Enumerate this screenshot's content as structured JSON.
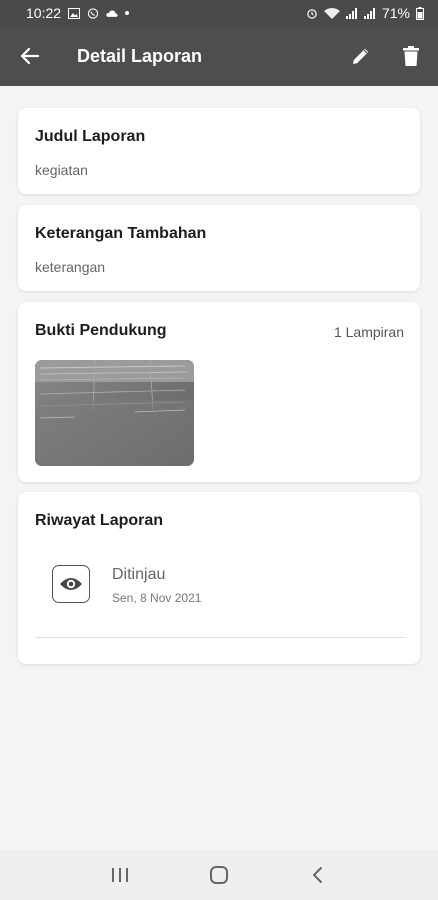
{
  "status_bar": {
    "time": "10:22",
    "battery": "71%",
    "left_icons": [
      "image-icon",
      "whatsapp-icon",
      "cloud-icon",
      "dot-icon"
    ],
    "right_icons": [
      "alarm-icon",
      "wifi-icon",
      "signal-icon",
      "signal-icon"
    ]
  },
  "app_bar": {
    "title": "Detail Laporan",
    "back_icon": "arrow-left-icon",
    "edit_icon": "pencil-icon",
    "delete_icon": "trash-icon"
  },
  "report": {
    "title_label": "Judul Laporan",
    "title_value": "kegiatan",
    "note_label": "Keterangan Tambahan",
    "note_value": "keterangan"
  },
  "evidence": {
    "label": "Bukti Pendukung",
    "count_text": "1 Lampiran",
    "thumbnail": "document-photo"
  },
  "history": {
    "label": "Riwayat Laporan",
    "items": [
      {
        "icon": "eye-icon",
        "status": "Ditinjau",
        "date": "Sen, 8 Nov 2021"
      }
    ]
  },
  "nav_bar": {
    "buttons": [
      "recents-icon",
      "home-icon",
      "back-icon"
    ]
  },
  "colors": {
    "app_bar": "#4e4e4e",
    "status_bar": "#4a4a4a",
    "background": "#f4f4f4",
    "card": "#ffffff"
  }
}
